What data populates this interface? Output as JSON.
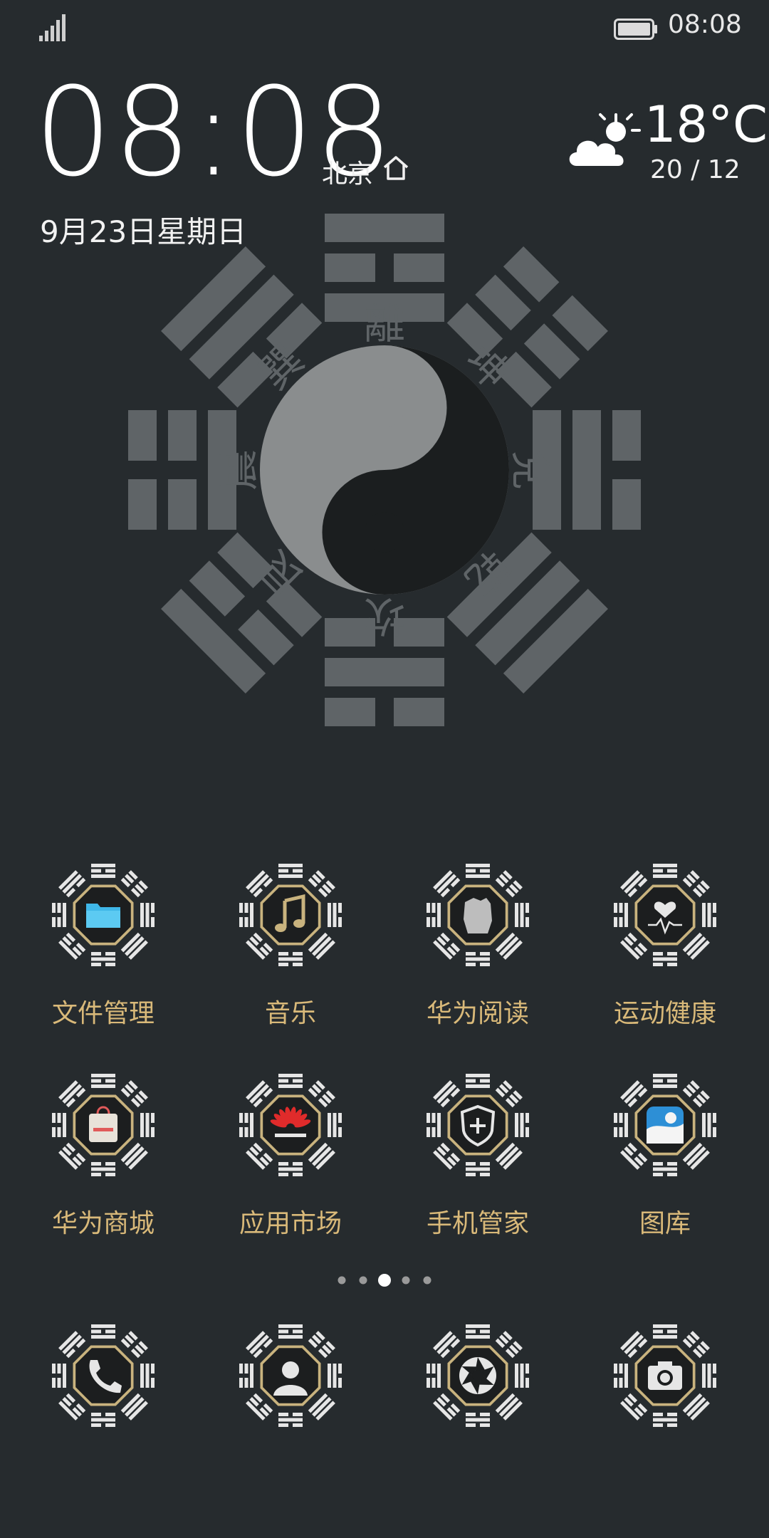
{
  "status_bar": {
    "time": "08:08"
  },
  "clock_widget": {
    "time": "08:08",
    "city": "北京",
    "date": "9月23日星期日"
  },
  "weather": {
    "temperature": "18°C",
    "range": "20 / 12",
    "icon": "partly-cloudy-icon"
  },
  "wallpaper": {
    "trigrams": [
      "離",
      "坤",
      "兌",
      "乾",
      "坎",
      "艮",
      "震",
      "巽"
    ]
  },
  "apps": [
    {
      "label": "文件管理",
      "icon": "folder-icon"
    },
    {
      "label": "音乐",
      "icon": "music-note-icon"
    },
    {
      "label": "华为阅读",
      "icon": "reading-hand-icon"
    },
    {
      "label": "运动健康",
      "icon": "heart-pulse-icon"
    },
    {
      "label": "华为商城",
      "icon": "shopping-bag-icon"
    },
    {
      "label": "应用市场",
      "icon": "huawei-logo-icon"
    },
    {
      "label": "手机管家",
      "icon": "shield-plus-icon"
    },
    {
      "label": "图库",
      "icon": "gallery-icon"
    }
  ],
  "dock": [
    {
      "icon": "phone-icon"
    },
    {
      "icon": "contacts-icon"
    },
    {
      "icon": "browser-aperture-icon"
    },
    {
      "icon": "camera-icon"
    }
  ],
  "page_indicator": {
    "pages": 5,
    "current": 3
  },
  "colors": {
    "background": "#262b2e",
    "bagua_gray": "#5f6467",
    "label_gold": "#d9b979",
    "icon_white": "#e6e6e6"
  }
}
